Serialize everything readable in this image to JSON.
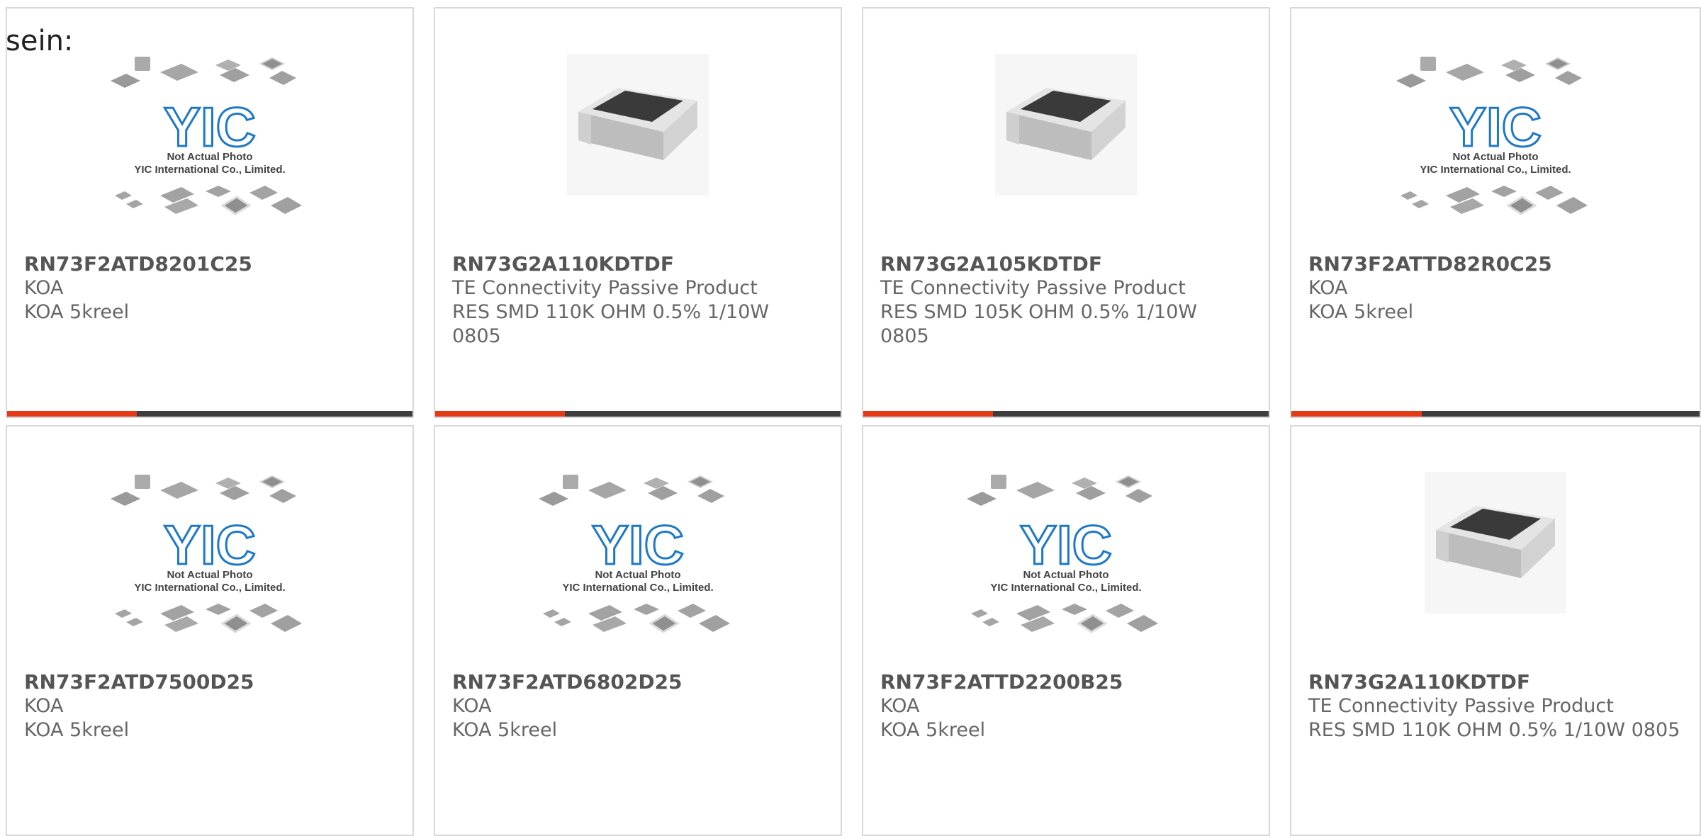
{
  "intro_text": "sein:",
  "colors": {
    "accent": "#e53a16",
    "track": "#3d3d3d",
    "logo_blue": "#1e78c8"
  },
  "placeholder": {
    "line1": "Not Actual Photo",
    "line2": "YIC International Co., Limited.",
    "logo": "YIC"
  },
  "products": [
    {
      "part_number": "RN73F2ATD8201C25",
      "manufacturer": "KOA",
      "description": "KOA 5kreel",
      "image": "placeholder",
      "progress": 0.32
    },
    {
      "part_number": "RN73G2A110KDTDF",
      "manufacturer": "TE Connectivity Passive Product",
      "description": "RES SMD 110K OHM 0.5% 1/10W 0805",
      "image": "resistor",
      "progress": 0.32
    },
    {
      "part_number": "RN73G2A105KDTDF",
      "manufacturer": "TE Connectivity Passive Product",
      "description": "RES SMD 105K OHM 0.5% 1/10W 0805",
      "image": "resistor",
      "progress": 0.32
    },
    {
      "part_number": "RN73F2ATTD82R0C25",
      "manufacturer": "KOA",
      "description": "KOA 5kreel",
      "image": "placeholder",
      "progress": 0.32
    },
    {
      "part_number": "RN73F2ATD7500D25",
      "manufacturer": "KOA",
      "description": "KOA 5kreel",
      "image": "placeholder",
      "progress": null
    },
    {
      "part_number": "RN73F2ATD6802D25",
      "manufacturer": "KOA",
      "description": "KOA 5kreel",
      "image": "placeholder",
      "progress": null
    },
    {
      "part_number": "RN73F2ATTD2200B25",
      "manufacturer": "KOA",
      "description": "KOA 5kreel",
      "image": "placeholder",
      "progress": null
    },
    {
      "part_number": "RN73G2A110KDTDF",
      "manufacturer": "TE Connectivity Passive Product",
      "description": "RES SMD 110K OHM 0.5% 1/10W 0805",
      "image": "resistor",
      "progress": null
    }
  ]
}
